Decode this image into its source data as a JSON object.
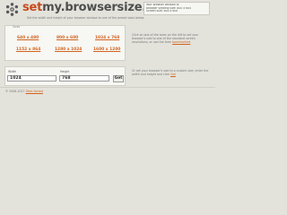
{
  "header": {
    "logo_text_prefix": "set",
    "logo_text_main": "my.browsersize.com",
    "tagline": "Set the width and height of your browser window to one of the preset sizes below"
  },
  "info_box": {
    "rows": [
      "Your browser window is:",
      "Browser viewing size: 800 x 600",
      "Screen size: 800 x 600"
    ]
  },
  "presets": {
    "tab_label": "Sizes",
    "sizes": [
      "640 x 480",
      "800 x 600",
      "1024 x 768",
      "1152 x 864",
      "1280 x 1024",
      "1600 x 1200"
    ]
  },
  "side_text": {
    "top": "Click on one of the sizes on the left to set your browser's size to one of the standard screen resolutions, or use the form ",
    "top_link": "bookmarklet",
    "mid": "Or set your browser's size to a custom size; enter the width and height and click ",
    "mid_link": "Get"
  },
  "form": {
    "width_label": "Width",
    "height_label": "Height",
    "width_value": "1024",
    "height_value": "768",
    "get_label": "Get"
  },
  "footer": {
    "copyright": "© 2008-2017 ",
    "link": "Sites Sorted"
  },
  "colors": {
    "background": "#e3e3dc",
    "accent": "#d1641f",
    "panel": "#f7f7f4"
  }
}
